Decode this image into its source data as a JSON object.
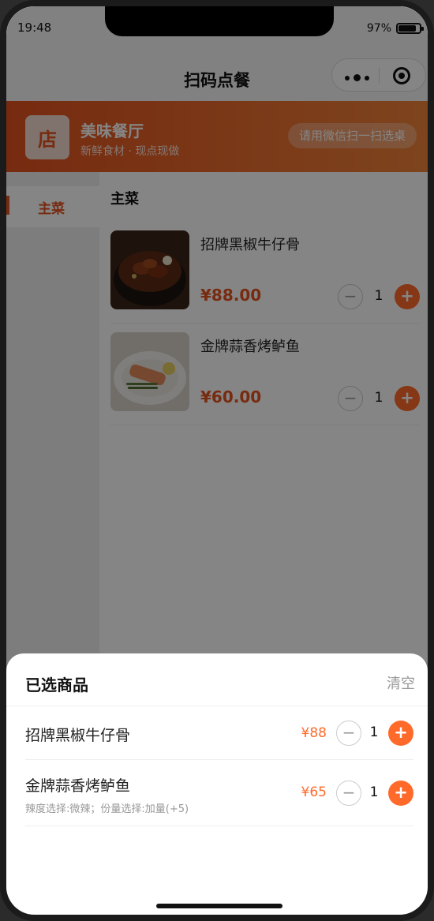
{
  "status_bar": {
    "time": "19:48",
    "battery": "97%"
  },
  "nav": {
    "title": "扫码点餐"
  },
  "store": {
    "logo_text": "店",
    "name": "美味餐厅",
    "desc": "新鲜食材 · 现点现做",
    "scan_label": "请用微信扫一扫选桌"
  },
  "sidebar": {
    "items": [
      {
        "label": "主菜",
        "active": true
      }
    ]
  },
  "menu": {
    "section_title": "主菜",
    "dishes": [
      {
        "name": "招牌黑椒牛仔骨",
        "price": "¥88.00",
        "qty": "1"
      },
      {
        "name": "金牌蒜香烤鲈鱼",
        "price": "¥60.00",
        "qty": "1"
      }
    ]
  },
  "stepper": {
    "minus": "−",
    "plus": "+"
  },
  "cart": {
    "title": "已选商品",
    "clear_label": "清空",
    "items": [
      {
        "name": "招牌黑椒牛仔骨",
        "spec": "",
        "price": "¥88",
        "qty": "1"
      },
      {
        "name": "金牌蒜香烤鲈鱼",
        "spec": "辣度选择:微辣；份量选择:加量(+5)",
        "price": "¥65",
        "qty": "1"
      }
    ]
  },
  "colors": {
    "accent": "#e5541f",
    "plus_button": "#ff6a2b"
  },
  "icons": {
    "menu": "more-dots-icon",
    "close": "target-circle-icon"
  }
}
